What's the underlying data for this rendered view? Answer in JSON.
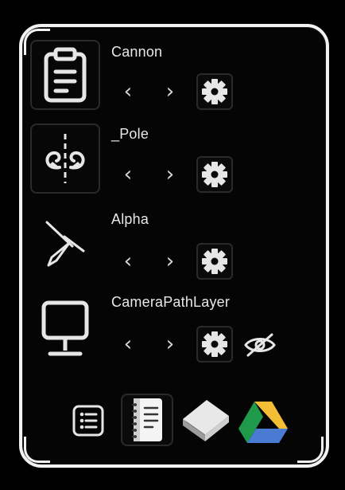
{
  "layers": [
    {
      "name": "Cannon",
      "icon": "clipboard-list-icon"
    },
    {
      "name": "_Pole",
      "icon": "pole-split-icon"
    },
    {
      "name": "Alpha",
      "icon": "flag-triangle-icon"
    },
    {
      "name": "CameraPathLayer",
      "icon": "monitor-icon"
    }
  ],
  "controls": {
    "prev": "‹",
    "next": "›"
  },
  "bottom_bar": [
    "list-icon",
    "notebook-icon",
    "book-icon",
    "google-drive-icon"
  ],
  "colors": {
    "background": "#000000",
    "border": "#f2f2f2",
    "icon": "#e6e6e6"
  }
}
